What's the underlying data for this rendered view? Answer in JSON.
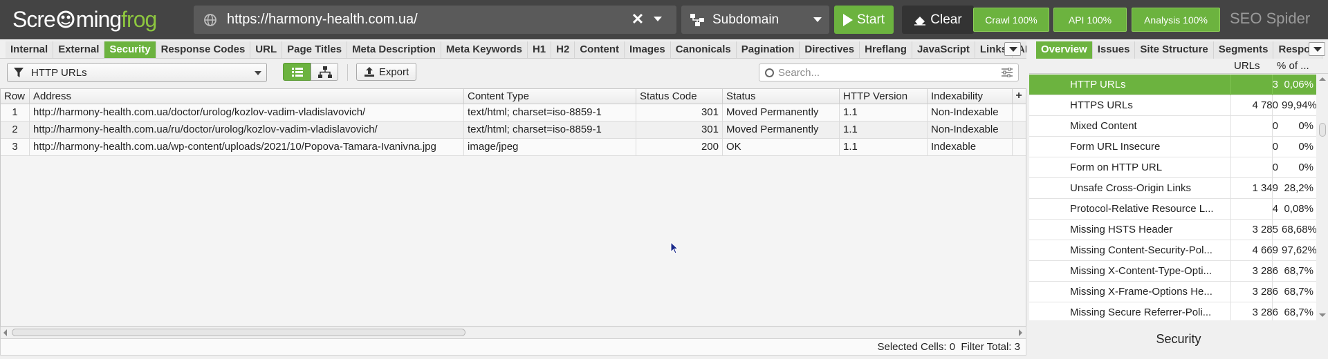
{
  "header": {
    "logo_text_white": "Scre",
    "logo_text_white2": "ming",
    "logo_text_green": "frog",
    "url_value": "https://harmony-health.com.ua/",
    "mode_label": "Subdomain",
    "start_label": "Start",
    "clear_label": "Clear",
    "crawl_progress": "Crawl 100%",
    "api_progress": "API 100%",
    "analysis_progress": "Analysis 100%",
    "product_title": "SEO Spider"
  },
  "tabs": [
    {
      "label": "Internal",
      "active": false
    },
    {
      "label": "External",
      "active": false
    },
    {
      "label": "Security",
      "active": true
    },
    {
      "label": "Response Codes",
      "active": false
    },
    {
      "label": "URL",
      "active": false
    },
    {
      "label": "Page Titles",
      "active": false
    },
    {
      "label": "Meta Description",
      "active": false
    },
    {
      "label": "Meta Keywords",
      "active": false
    },
    {
      "label": "H1",
      "active": false
    },
    {
      "label": "H2",
      "active": false
    },
    {
      "label": "Content",
      "active": false
    },
    {
      "label": "Images",
      "active": false
    },
    {
      "label": "Canonicals",
      "active": false
    },
    {
      "label": "Pagination",
      "active": false
    },
    {
      "label": "Directives",
      "active": false
    },
    {
      "label": "Hreflang",
      "active": false
    },
    {
      "label": "JavaScript",
      "active": false
    },
    {
      "label": "Links",
      "active": false
    },
    {
      "label": "AI",
      "active": false
    }
  ],
  "right_tabs": [
    {
      "label": "Overview",
      "active": true
    },
    {
      "label": "Issues",
      "active": false
    },
    {
      "label": "Site Structure",
      "active": false
    },
    {
      "label": "Segments",
      "active": false
    },
    {
      "label": "Respon",
      "active": false
    }
  ],
  "toolbar": {
    "filter_label": "HTTP URLs",
    "export_label": "Export",
    "search_placeholder": "Search..."
  },
  "table": {
    "headers": {
      "row": "Row",
      "address": "Address",
      "content_type": "Content Type",
      "status_code": "Status Code",
      "status": "Status",
      "http_version": "HTTP Version",
      "indexability": "Indexability"
    },
    "rows": [
      {
        "row": "1",
        "address": "http://harmony-health.com.ua/doctor/urolog/kozlov-vadim-vladislavovich/",
        "content_type": "text/html; charset=iso-8859-1",
        "status_code": "301",
        "status": "Moved Permanently",
        "http_version": "1.1",
        "indexability": "Non-Indexable"
      },
      {
        "row": "2",
        "address": "http://harmony-health.com.ua/ru/doctor/urolog/kozlov-vadim-vladislavovich/",
        "content_type": "text/html; charset=iso-8859-1",
        "status_code": "301",
        "status": "Moved Permanently",
        "http_version": "1.1",
        "indexability": "Non-Indexable"
      },
      {
        "row": "3",
        "address": "http://harmony-health.com.ua/wp-content/uploads/2021/10/Popova-Tamara-Ivanivna.jpg",
        "content_type": "image/jpeg",
        "status_code": "200",
        "status": "OK",
        "http_version": "1.1",
        "indexability": "Indexable"
      }
    ]
  },
  "statusbar": {
    "selected_label": "Selected Cells:",
    "selected_value": "0",
    "filter_label": "Filter Total:",
    "filter_value": "3"
  },
  "overview": {
    "col_urls": "URLs",
    "col_percent": "% of ...",
    "items": [
      {
        "label": "HTTP URLs",
        "count": "3",
        "percent": "0,06%",
        "selected": true
      },
      {
        "label": "HTTPS URLs",
        "count": "4 780",
        "percent": "99,94%",
        "selected": false
      },
      {
        "label": "Mixed Content",
        "count": "0",
        "percent": "0%",
        "selected": false
      },
      {
        "label": "Form URL Insecure",
        "count": "0",
        "percent": "0%",
        "selected": false
      },
      {
        "label": "Form on HTTP URL",
        "count": "0",
        "percent": "0%",
        "selected": false
      },
      {
        "label": "Unsafe Cross-Origin Links",
        "count": "1 349",
        "percent": "28,2%",
        "selected": false
      },
      {
        "label": "Protocol-Relative Resource L...",
        "count": "4",
        "percent": "0,08%",
        "selected": false
      },
      {
        "label": "Missing HSTS Header",
        "count": "3 285",
        "percent": "68,68%",
        "selected": false
      },
      {
        "label": "Missing Content-Security-Pol...",
        "count": "4 669",
        "percent": "97,62%",
        "selected": false
      },
      {
        "label": "Missing X-Content-Type-Opti...",
        "count": "3 286",
        "percent": "68,7%",
        "selected": false
      },
      {
        "label": "Missing X-Frame-Options He...",
        "count": "3 286",
        "percent": "68,7%",
        "selected": false
      },
      {
        "label": "Missing Secure Referrer-Poli...",
        "count": "3 286",
        "percent": "68,7%",
        "selected": false
      }
    ],
    "chart_title": "Security"
  },
  "colors": {
    "accent_green": "#6cb33f",
    "topbar_bg": "#444444"
  }
}
